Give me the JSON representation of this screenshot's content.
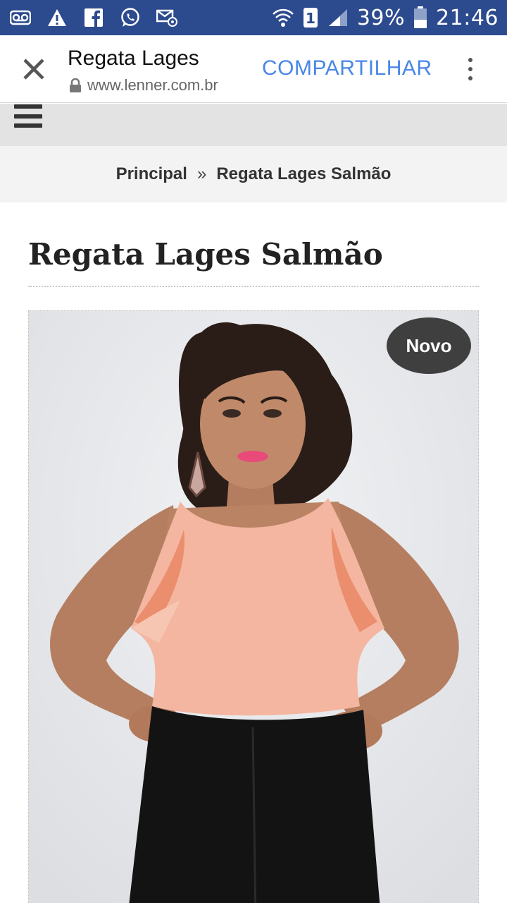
{
  "status_bar": {
    "left_icons": [
      "voicemail-icon",
      "warning-icon",
      "facebook-icon",
      "whatsapp-icon",
      "email-icon"
    ],
    "battery": "39%",
    "time": "21:46",
    "sim_slot": "1"
  },
  "toolbar": {
    "title": "Regata Lages",
    "url": "www.lenner.com.br",
    "share_label": "COMPARTILHAR"
  },
  "breadcrumb": {
    "home": "Principal",
    "separator": "»",
    "current": "Regata Lages Salmão"
  },
  "product": {
    "title": "Regata Lages Salmão",
    "badge": "Novo"
  },
  "colors": {
    "status_bar": "#2c4a8e",
    "share_link": "#4a86e8",
    "badge_bg": "#3f3f40",
    "top_color": "#f4b6a0"
  }
}
